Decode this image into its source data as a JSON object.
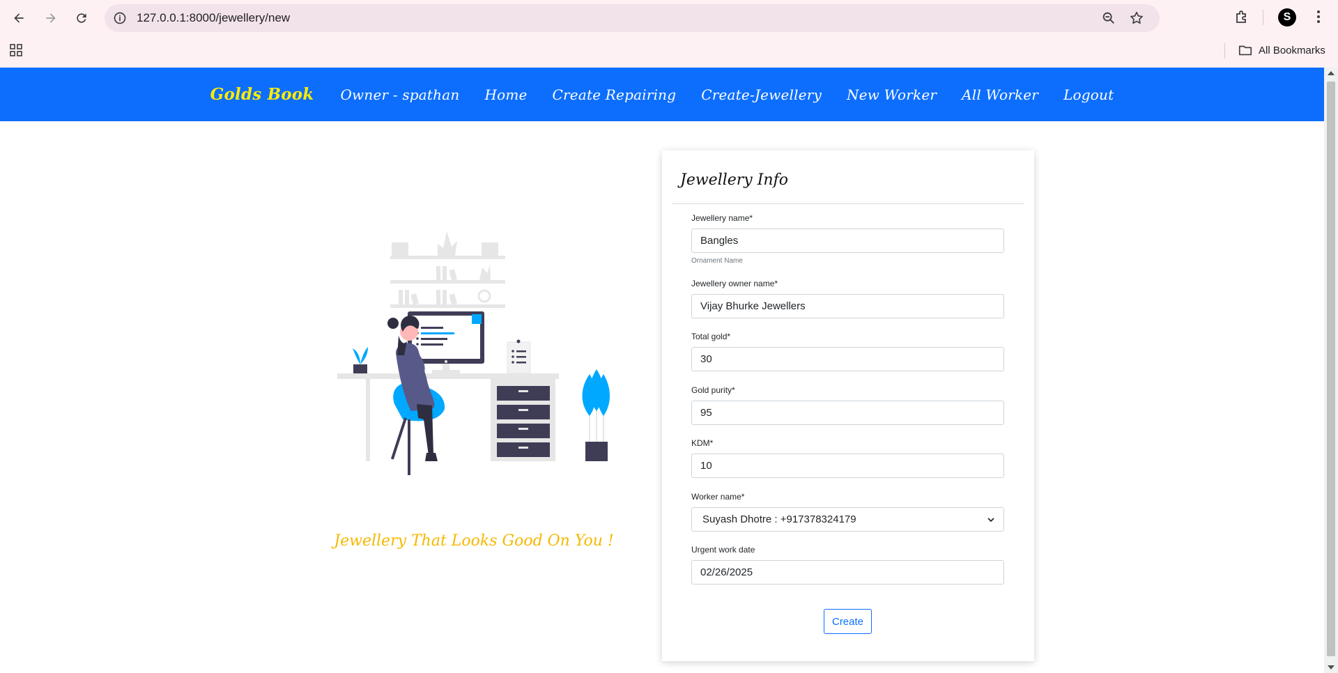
{
  "browser": {
    "url": "127.0.0.1:8000/jewellery/new",
    "all_bookmarks": "All Bookmarks",
    "profile_letter": "S"
  },
  "nav": {
    "brand": "Golds Book",
    "items": [
      "Owner - spathan",
      "Home",
      "Create Repairing",
      "Create-Jewellery",
      "New Worker",
      "All Worker",
      "Logout"
    ]
  },
  "hero": {
    "tagline": "Jewellery That Looks Good On You !"
  },
  "form": {
    "title": "Jewellery Info",
    "jewellery_name": {
      "label": "Jewellery name*",
      "value": "Bangles",
      "help": "Ornament Name"
    },
    "owner_name": {
      "label": "Jewellery owner name*",
      "value": "Vijay Bhurke Jewellers"
    },
    "total_gold": {
      "label": "Total gold*",
      "value": "30"
    },
    "gold_purity": {
      "label": "Gold purity*",
      "value": "95"
    },
    "kdm": {
      "label": "KDM*",
      "value": "10"
    },
    "worker_name": {
      "label": "Worker name*",
      "selected": "Suyash Dhotre : +917378324179"
    },
    "urgent_date": {
      "label": "Urgent work date",
      "value": "02/26/2025"
    },
    "submit_label": "Create"
  },
  "colors": {
    "navbar": "#0d6efd",
    "brand": "#ffeb00",
    "tagline": "#f5b800",
    "accent_plant": "#00a8ff",
    "illustration_dark": "#3f3d56"
  }
}
